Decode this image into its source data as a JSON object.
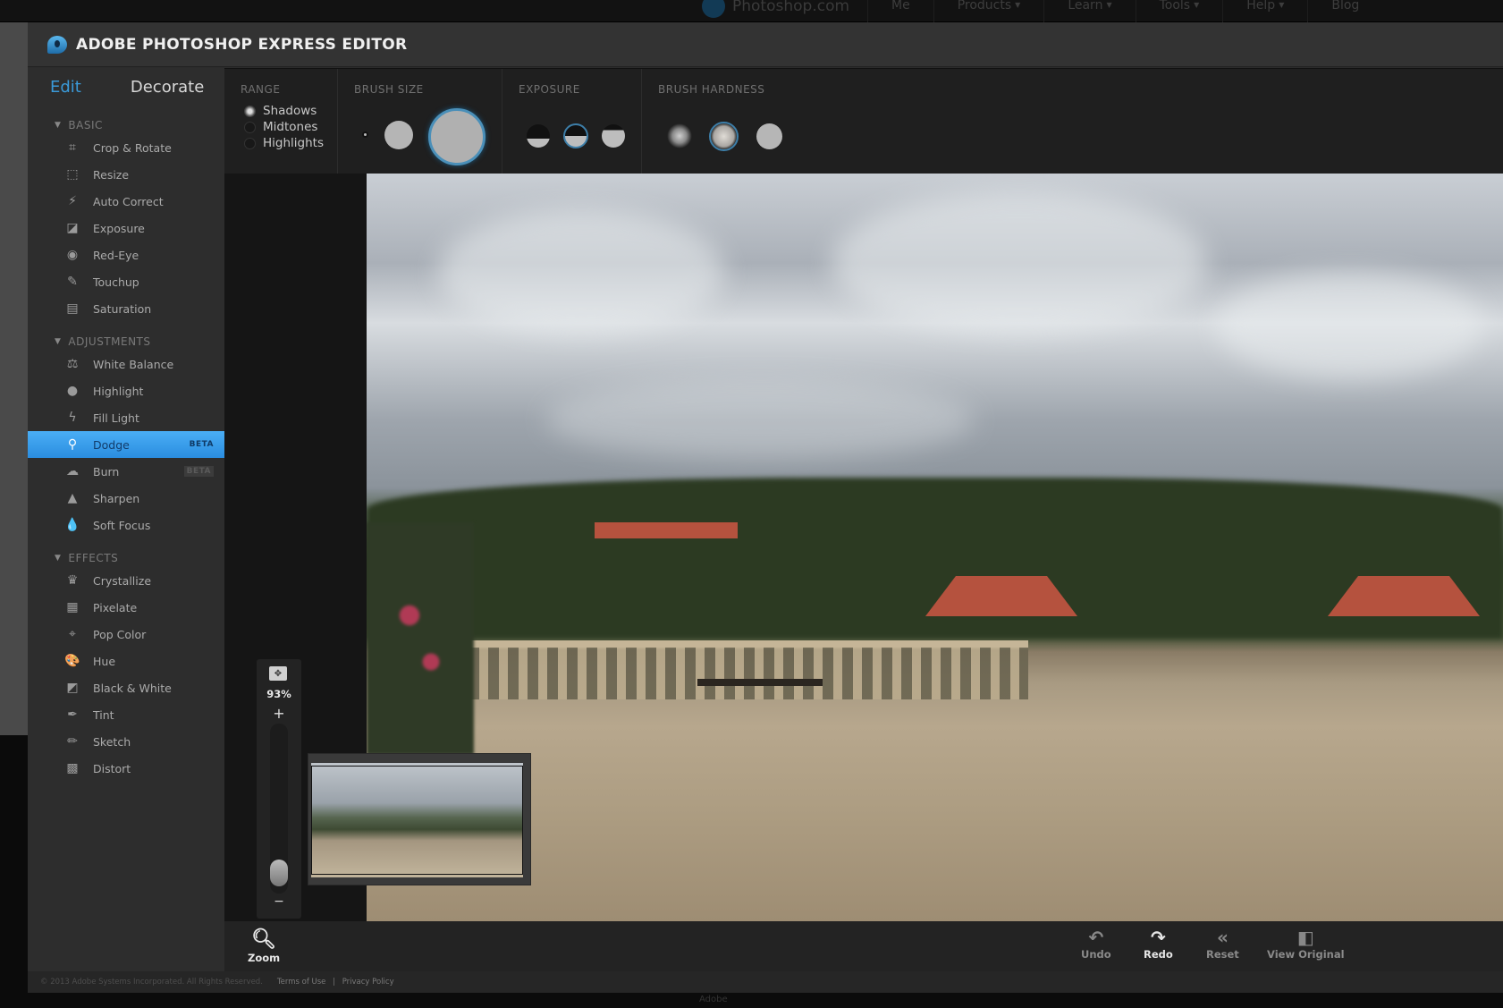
{
  "site_nav": {
    "logo_text": "Photoshop.com",
    "items": [
      {
        "label": "Me",
        "has_caret": false
      },
      {
        "label": "Products",
        "has_caret": true
      },
      {
        "label": "Learn",
        "has_caret": true
      },
      {
        "label": "Tools",
        "has_caret": true
      },
      {
        "label": "Help",
        "has_caret": true
      },
      {
        "label": "Blog",
        "has_caret": false
      }
    ],
    "caret_glyph": "▼"
  },
  "app": {
    "title": "ADOBE PHOTOSHOP EXPRESS EDITOR",
    "accent_color": "#3a9ad9"
  },
  "sidebar": {
    "tabs": [
      {
        "label": "Edit",
        "active": true
      },
      {
        "label": "Decorate",
        "active": false
      }
    ],
    "sections": [
      {
        "title": "BASIC",
        "items": [
          {
            "label": "Crop & Rotate",
            "icon": "crop-icon",
            "glyph": "⌗"
          },
          {
            "label": "Resize",
            "icon": "resize-icon",
            "glyph": "⬚"
          },
          {
            "label": "Auto Correct",
            "icon": "magic-wand-icon",
            "glyph": "⚡"
          },
          {
            "label": "Exposure",
            "icon": "exposure-icon",
            "glyph": "◪"
          },
          {
            "label": "Red-Eye",
            "icon": "eye-icon",
            "glyph": "◉"
          },
          {
            "label": "Touchup",
            "icon": "bandage-icon",
            "glyph": "✎"
          },
          {
            "label": "Saturation",
            "icon": "saturation-icon",
            "glyph": "▤"
          }
        ]
      },
      {
        "title": "ADJUSTMENTS",
        "items": [
          {
            "label": "White Balance",
            "icon": "scales-icon",
            "glyph": "⚖"
          },
          {
            "label": "Highlight",
            "icon": "lightbulb-icon",
            "glyph": "●"
          },
          {
            "label": "Fill Light",
            "icon": "lightning-icon",
            "glyph": "ϟ"
          },
          {
            "label": "Dodge",
            "icon": "dodge-magnifier-icon",
            "glyph": "⚲",
            "active": true,
            "badge": "BETA"
          },
          {
            "label": "Burn",
            "icon": "burn-hand-icon",
            "glyph": "☁",
            "badge": "BETA"
          },
          {
            "label": "Sharpen",
            "icon": "sharpen-icon",
            "glyph": "▲"
          },
          {
            "label": "Soft Focus",
            "icon": "droplet-icon",
            "glyph": "💧"
          }
        ]
      },
      {
        "title": "EFFECTS",
        "items": [
          {
            "label": "Crystallize",
            "icon": "crystallize-icon",
            "glyph": "♛"
          },
          {
            "label": "Pixelate",
            "icon": "pixelate-icon",
            "glyph": "▦"
          },
          {
            "label": "Pop Color",
            "icon": "target-icon",
            "glyph": "⌖"
          },
          {
            "label": "Hue",
            "icon": "palette-icon",
            "glyph": "🎨"
          },
          {
            "label": "Black & White",
            "icon": "black-white-icon",
            "glyph": "◩"
          },
          {
            "label": "Tint",
            "icon": "eyedropper-icon",
            "glyph": "✒"
          },
          {
            "label": "Sketch",
            "icon": "pencil-icon",
            "glyph": "✏"
          },
          {
            "label": "Distort",
            "icon": "distort-icon",
            "glyph": "▩"
          }
        ]
      }
    ]
  },
  "options": {
    "range": {
      "label": "RANGE",
      "options": [
        "Shadows",
        "Midtones",
        "Highlights"
      ],
      "selected": "Shadows"
    },
    "brush_size": {
      "label": "BRUSH SIZE",
      "options": [
        "small",
        "medium",
        "large"
      ],
      "selected": "large"
    },
    "exposure": {
      "label": "EXPOSURE",
      "options": [
        "low",
        "medium",
        "high"
      ],
      "selected": "medium"
    },
    "brush_hardness": {
      "label": "BRUSH HARDNESS",
      "options": [
        "soft",
        "medium",
        "hard"
      ],
      "selected": "medium"
    }
  },
  "zoom": {
    "percent_label": "93%",
    "plus": "+",
    "minus": "−",
    "slider_fraction": 0.05
  },
  "bottom": {
    "zoom_label": "Zoom",
    "undo_label": "Undo",
    "redo_label": "Redo",
    "reset_label": "Reset",
    "view_original_label": "View Original"
  },
  "footer": {
    "copyright": "© 2013 Adobe Systems Incorporated. All Rights Reserved.",
    "terms": "Terms of Use",
    "separator": "|",
    "privacy": "Privacy Policy"
  },
  "page_footer_text": "Adobe"
}
